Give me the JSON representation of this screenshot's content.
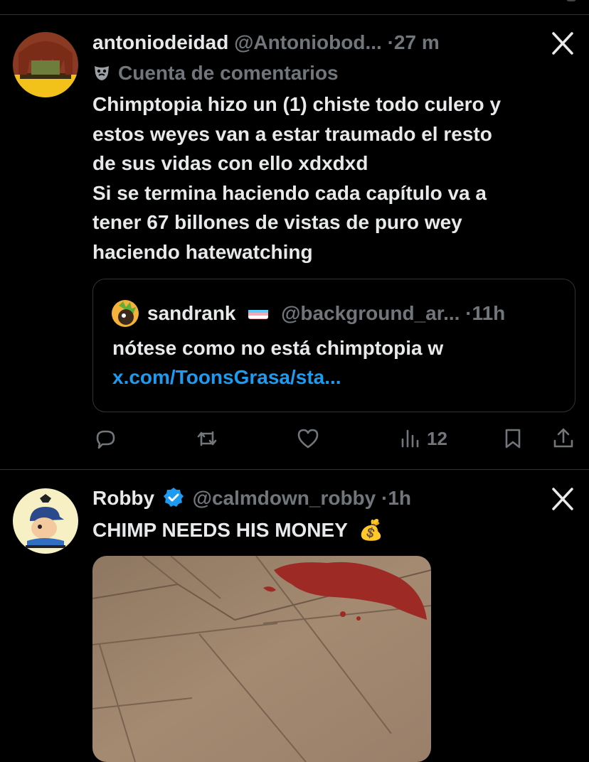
{
  "tweet1": {
    "display_name": "antoniodeidad",
    "handle": "@Antoniobod...",
    "separator": "·",
    "time": "27 m",
    "sub_label": "Cuenta de comentarios",
    "sub_icon": "mask-icon",
    "text_lines": [
      "Chimptopia hizo un (1) chiste todo culero y",
      "estos weyes van a estar traumado el resto",
      "de sus vidas con ello xdxdxd",
      "Si se termina haciendo cada capítulo va a",
      "tener 67 billones de vistas de puro wey",
      "haciendo hatewatching"
    ],
    "quote": {
      "display_name": "sandrank",
      "flag": "trans-flag-icon",
      "handle": "@background_ar...",
      "separator": "·",
      "time": "11h",
      "text": "nótese como no está chimptopia w",
      "link": "x.com/ToonsGrasa/sta..."
    },
    "actions": {
      "views_count": "12"
    }
  },
  "tweet2": {
    "display_name": "Robby",
    "handle": "@calmdown_robby",
    "separator": "·",
    "time": "1h",
    "text": "CHIMP NEEDS HIS MONEY",
    "emoji": "💰"
  },
  "colors": {
    "background": "#000000",
    "text": "#e7e9ea",
    "muted": "#71767b",
    "link": "#1d9bf0",
    "verified": "#1d9bf0",
    "divider": "#2f3336"
  }
}
